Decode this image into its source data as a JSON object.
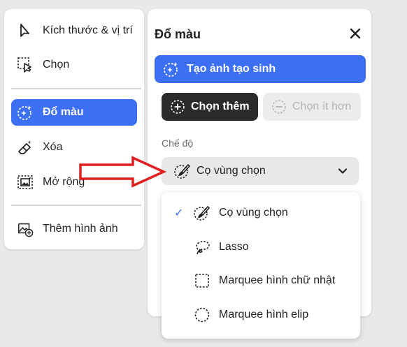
{
  "tool_panel": {
    "items": [
      {
        "label": "Kích thước & vị trí",
        "icon": "cursor-arrow-icon"
      },
      {
        "label": "Chọn",
        "icon": "selection-cursor-icon"
      },
      {
        "label": "Đổ màu",
        "icon": "generative-fill-icon",
        "active": true
      },
      {
        "label": "Xóa",
        "icon": "eraser-icon"
      },
      {
        "label": "Mở rộng",
        "icon": "expand-icon"
      },
      {
        "label": "Thêm hình ảnh",
        "icon": "add-image-icon"
      }
    ]
  },
  "fill_panel": {
    "title": "Đổ màu",
    "generate_button": "Tạo ảnh tạo sinh",
    "add_button": "Chọn thêm",
    "subtract_button": "Chọn ít hơn",
    "mode_label": "Chế độ",
    "mode_value": "Cọ vùng chọn"
  },
  "dropdown": {
    "options": [
      {
        "label": "Cọ vùng chọn",
        "icon": "selection-brush-icon",
        "selected": true
      },
      {
        "label": "Lasso",
        "icon": "lasso-icon"
      },
      {
        "label": "Marquee hình chữ nhật",
        "icon": "rectangle-marquee-icon"
      },
      {
        "label": "Marquee hình elip",
        "icon": "ellipse-marquee-icon"
      }
    ]
  },
  "colors": {
    "accent": "#3d6ff5",
    "dark_button": "#2b2b2b",
    "annotation_arrow": "#e02020"
  }
}
